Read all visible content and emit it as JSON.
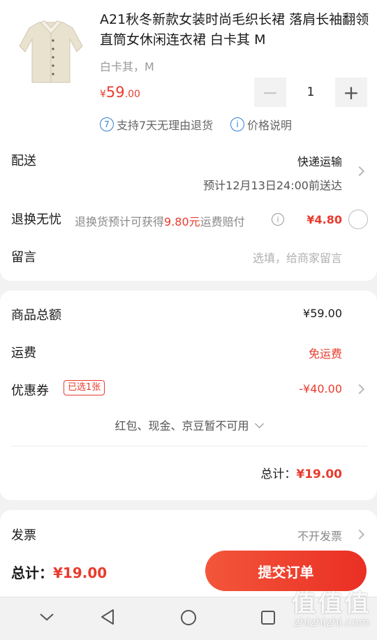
{
  "product": {
    "title": "A21秋冬新款女装时尚毛织长裙 落肩长袖翻领直筒女休闲连衣裙 白卡其 M",
    "variant": "白卡其，M",
    "price_currency": "¥",
    "price_int": "59",
    "price_dec": ".00",
    "quantity": "1",
    "minus": "−",
    "plus": "+"
  },
  "policy": {
    "return_icon": "7",
    "return_text": "支持7天无理由退货",
    "price_icon": "i",
    "price_text": "价格说明"
  },
  "delivery": {
    "label": "配送",
    "method": "快递运输",
    "eta": "预计12月13日24:00前送达"
  },
  "return_worry": {
    "label": "退换无忧",
    "sub_before": "退换货预计可获得",
    "sub_amount": "9.80元",
    "sub_after": "运费赔付",
    "info_icon": "i",
    "price": "¥4.80"
  },
  "message": {
    "label": "留言",
    "placeholder": "选填，给商家留言"
  },
  "summary": {
    "goods_label": "商品总额",
    "goods_value": "¥59.00",
    "shipping_label": "运费",
    "shipping_value": "免运费",
    "coupon_label": "优惠券",
    "coupon_badge": "已选1张",
    "coupon_value": "-¥40.00",
    "unavailable": "红包、现金、京豆暂不可用",
    "total_label": "总计：",
    "total_value": "¥19.00"
  },
  "invoice": {
    "label": "发票",
    "value": "不开发票"
  },
  "footer": {
    "total_label": "总计：",
    "total_value": "¥19.00",
    "submit": "提交订单"
  },
  "watermark": {
    "big": "值值值",
    "small": "zhizhizhi.com"
  },
  "icons": {
    "nav_back": "triangle-back-icon",
    "nav_home": "circle-home-icon",
    "nav_recent": "square-recent-icon",
    "nav_down": "chevron-down-icon"
  },
  "colors": {
    "accent": "#e93b2d",
    "link_blue": "#2e7fd3"
  }
}
